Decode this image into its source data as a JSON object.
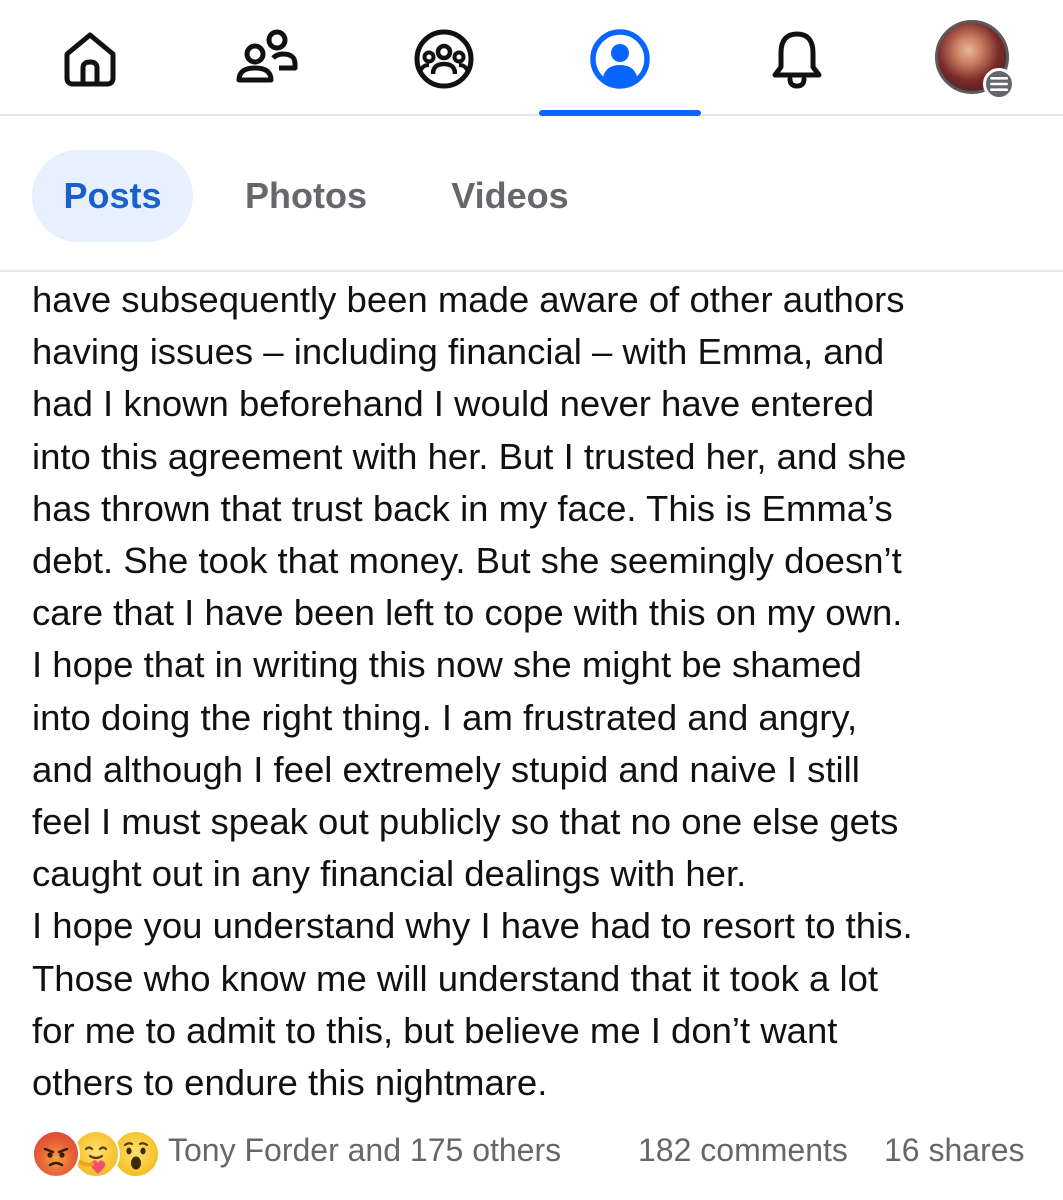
{
  "nav": {
    "items": [
      {
        "name": "home",
        "icon": "home-icon"
      },
      {
        "name": "friends",
        "icon": "friends-icon"
      },
      {
        "name": "groups",
        "icon": "groups-icon"
      },
      {
        "name": "profile",
        "icon": "profile-icon",
        "active": true
      },
      {
        "name": "notifications",
        "icon": "bell-icon"
      },
      {
        "name": "menu",
        "icon": "avatar-menu-icon"
      }
    ],
    "accent_color": "#0866ff"
  },
  "tabs": [
    {
      "label": "Posts",
      "active": true
    },
    {
      "label": "Photos",
      "active": false
    },
    {
      "label": "Videos",
      "active": false
    }
  ],
  "post": {
    "lines": [
      "have subsequently been made aware of other authors",
      "having issues – including financial – with Emma, and",
      "had I known beforehand I would never have entered",
      "into this agreement with her. But I trusted her, and she",
      "has thrown that trust back in my face. This is Emma’s",
      "debt. She took that money. But she seemingly doesn’t",
      "care that I have been left to cope with this on my own.",
      "I hope that in writing this now she might be shamed",
      "into doing the right thing. I am frustrated and angry,",
      "and although I feel extremely stupid and naive I still",
      "feel I must speak out publicly so that no one else gets",
      "caught out in any financial dealings with her.",
      "I hope you understand why I have had to resort to this.",
      "Those who know me will understand that it took a lot",
      "for me to admit to this, but believe me I don’t want",
      "others to endure this nightmare."
    ]
  },
  "footer": {
    "reactions": [
      "angry-reaction-icon",
      "care-reaction-icon",
      "wow-reaction-icon"
    ],
    "reactors_text": "Tony Forder and 175 others",
    "comments_text": "182 comments",
    "shares_text": "16 shares"
  }
}
